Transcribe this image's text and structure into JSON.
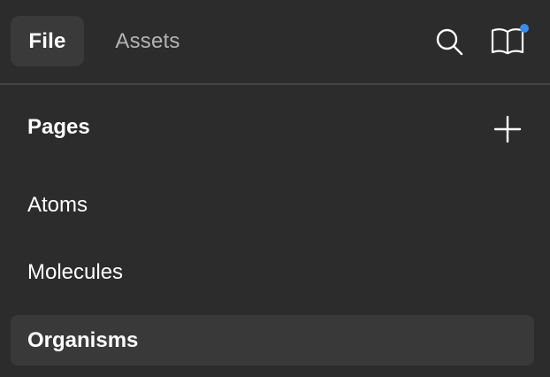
{
  "tabs": [
    {
      "label": "File",
      "active": true
    },
    {
      "label": "Assets",
      "active": false
    }
  ],
  "header_icons": {
    "search": "search-icon",
    "library": "book-icon",
    "library_has_notification": true,
    "notification_color": "#3b8bea"
  },
  "pages": {
    "title": "Pages",
    "add_icon": "plus-icon",
    "items": [
      {
        "label": "Atoms",
        "selected": false
      },
      {
        "label": "Molecules",
        "selected": false
      },
      {
        "label": "Organisms",
        "selected": true
      }
    ]
  },
  "colors": {
    "background": "#2c2c2c",
    "tab_active_bg": "#3a3a3a",
    "selected_item_bg": "#393939",
    "divider": "#444444",
    "text_primary": "#ffffff",
    "text_secondary": "#b3b3b3"
  }
}
